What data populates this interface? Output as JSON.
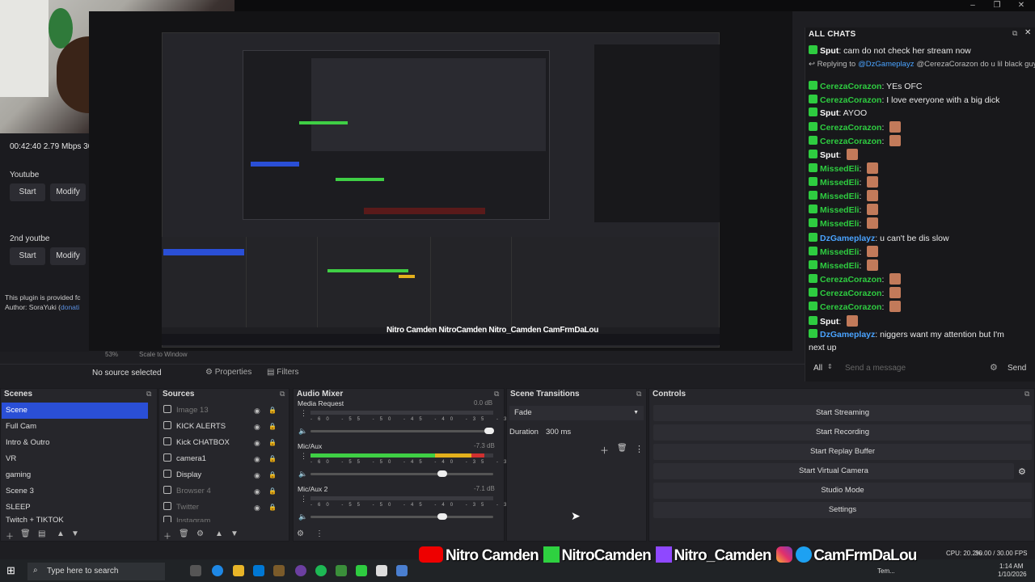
{
  "window": {
    "minimize": "–",
    "maximize": "❐",
    "close": "✕"
  },
  "left_dock": {
    "stats": "00:42:40  2.79 Mbps  30",
    "groups": [
      {
        "label": "Youtube",
        "start": "Start",
        "modify": "Modify"
      },
      {
        "label": "2nd youtbe",
        "start": "Start",
        "modify": "Modify"
      }
    ],
    "plugin_text": "This plugin is provided fc",
    "plugin_author": "Author: SoraYuki (",
    "plugin_link": "donati"
  },
  "preview": {
    "zoom": "53%",
    "scale": "Scale to Window",
    "banner": "Nitro Camden  NitroCamden  Nitro_Camden  CamFrmDaLou"
  },
  "chat": {
    "title": "ALL CHATS",
    "messages": [
      {
        "user": "Sput",
        "text": "cam do not check her stream now"
      },
      {
        "reply": "Replying to",
        "reply_user": "@DzGameplayz",
        "text": "@CerezaCorazon do u lil black guys?"
      },
      {
        "user": "CerezaCorazon",
        "text": "YEs OFC"
      },
      {
        "user": "CerezaCorazon",
        "text": "I love everyone with a big dick"
      },
      {
        "user": "Sput",
        "text": "AYOO"
      },
      {
        "user": "CerezaCorazon",
        "text": ""
      },
      {
        "user": "CerezaCorazon",
        "text": ""
      },
      {
        "user": "Sput",
        "text": ""
      },
      {
        "user": "MissedEli",
        "text": ""
      },
      {
        "user": "MissedEli",
        "text": ""
      },
      {
        "user": "MissedEli",
        "text": ""
      },
      {
        "user": "MissedEli",
        "text": ""
      },
      {
        "user": "MissedEli",
        "text": ""
      },
      {
        "user": "DzGameplayz",
        "text": "u can't be dis slow"
      },
      {
        "user": "MissedEli",
        "text": ""
      },
      {
        "user": "MissedEli",
        "text": ""
      },
      {
        "user": "CerezaCorazon",
        "text": ""
      },
      {
        "user": "CerezaCorazon",
        "text": ""
      },
      {
        "user": "CerezaCorazon",
        "text": ""
      },
      {
        "user": "Sput",
        "text": ""
      },
      {
        "user": "DzGameplayz",
        "text": "niggers want my attention but I'm"
      },
      {
        "user": "",
        "text": "next up"
      }
    ],
    "filter": "All",
    "placeholder": "Send a message",
    "send": "Send"
  },
  "source_bar": {
    "no_source": "No source selected",
    "properties": "Properties",
    "filters": "Filters"
  },
  "scenes": {
    "title": "Scenes",
    "items": [
      "Scene",
      "Full Cam",
      "Intro & Outro",
      "VR",
      "gaming",
      "Scene 3",
      "SLEEP",
      "Twitch + TIKTOK"
    ]
  },
  "sources": {
    "title": "Sources",
    "items": [
      "Image 13",
      "KICK ALERTS",
      "Kick CHATBOX",
      "camera1",
      "Display",
      "Browser 4",
      "Twitter",
      "Instagram"
    ]
  },
  "mixer": {
    "title": "Audio Mixer",
    "channels": [
      {
        "name": "Media Request",
        "db": "0.0 dB",
        "level": 0.0
      },
      {
        "name": "Mic/Aux",
        "db": "-7.3 dB",
        "level": 0.95
      },
      {
        "name": "Mic/Aux 2",
        "db": "-7.1 dB",
        "level": 0.0
      }
    ],
    "scale": "-60 -55 -50 -45 -40 -35 -30 -25 -20 -15 -10 -5 0"
  },
  "transitions": {
    "title": "Scene Transitions",
    "type": "Fade",
    "duration_label": "Duration",
    "duration": "300 ms"
  },
  "controls": {
    "title": "Controls",
    "buttons": [
      "Start Streaming",
      "Start Recording",
      "Start Replay Buffer",
      "Start Virtual Camera",
      "Studio Mode",
      "Settings"
    ]
  },
  "taskbar": {
    "search": "Type here to search",
    "banner": [
      "Nitro Camden",
      "NitroCamden",
      "Nitro_Camden",
      "CamFrmDaLou"
    ],
    "cpu": "CPU: 20.2%",
    "fps": "30.00 / 30.00 FPS",
    "time": "1:14 AM",
    "date": "1/10/2026",
    "tray_label": "Tem..."
  }
}
